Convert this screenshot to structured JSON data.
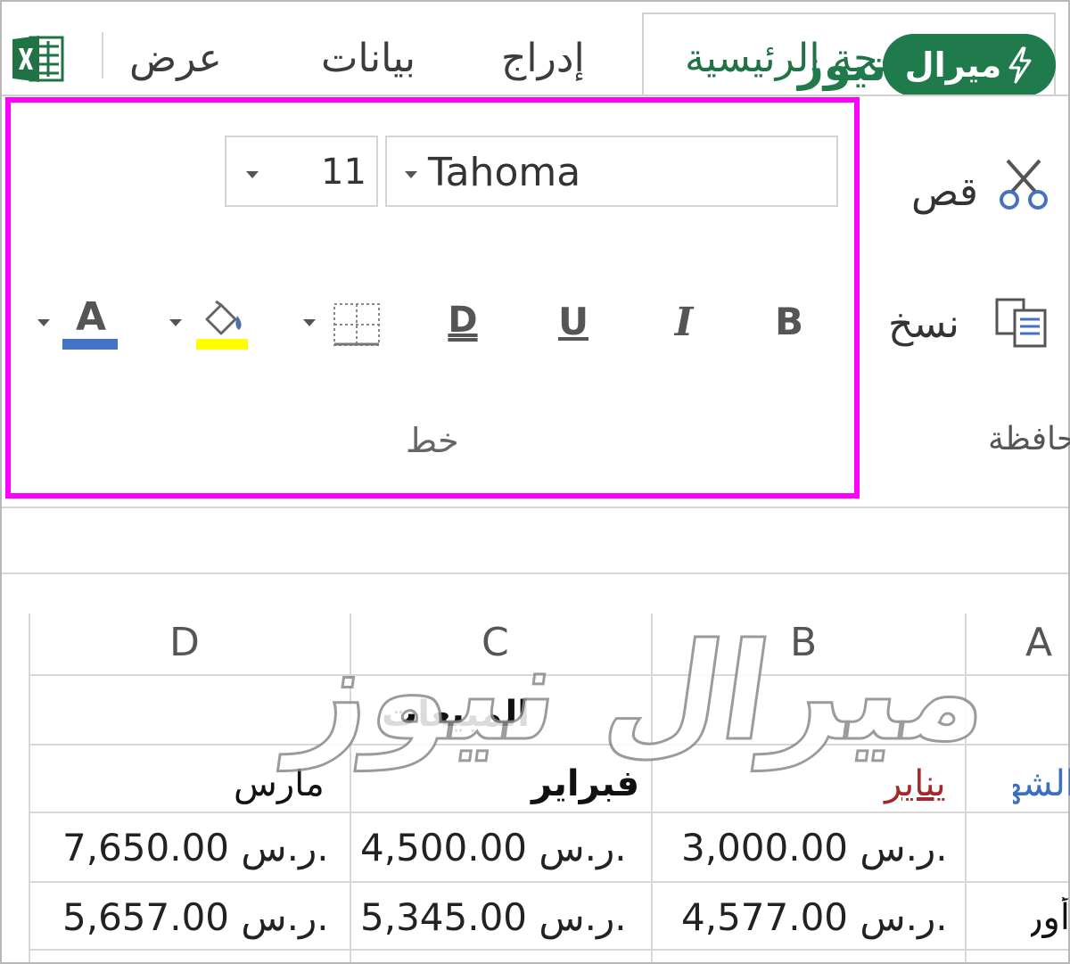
{
  "tabs": {
    "view": "عرض",
    "data": "بيانات",
    "insert": "إدراج",
    "home": "الصفحة الرئيسية"
  },
  "brand": {
    "badge_text": "ميرال",
    "overlap_text": "نيوز",
    "color": "#1f7a4c"
  },
  "ribbon": {
    "font_name": "Tahoma",
    "font_size": "11",
    "bold": "B",
    "italic": "I",
    "underline": "U",
    "double_underline": "D",
    "font_color_letter": "A",
    "font_color": "#4472c4",
    "fill_color": "#ffff00",
    "highlight_color": "#ff00ff",
    "font_group_label": "خط",
    "cut_label": "قص",
    "copy_label": "نسخ",
    "clipboard_label": "حافظة"
  },
  "sheet": {
    "columns": [
      "A",
      "B",
      "C",
      "D"
    ],
    "title": "المبيعات",
    "row_label_header": "الشهر",
    "months": [
      "يناير",
      "فبراير",
      "مارس"
    ],
    "rows": [
      {
        "label": "",
        "values": [
          "3,000.00 ر.س.",
          "4,500.00 ر.س.",
          "7,650.00 ر.س."
        ]
      },
      {
        "label": "أوربا",
        "values": [
          "4,577.00 ر.س.",
          "5,345.00 ر.س.",
          "5,657.00 ر.س."
        ]
      }
    ]
  },
  "watermark": {
    "text": "ميرال نيوز"
  },
  "icons": [
    "excel-icon",
    "scissors-icon",
    "copy-icon",
    "borders-icon",
    "fill-color-icon",
    "font-color-icon",
    "bolt-icon"
  ]
}
